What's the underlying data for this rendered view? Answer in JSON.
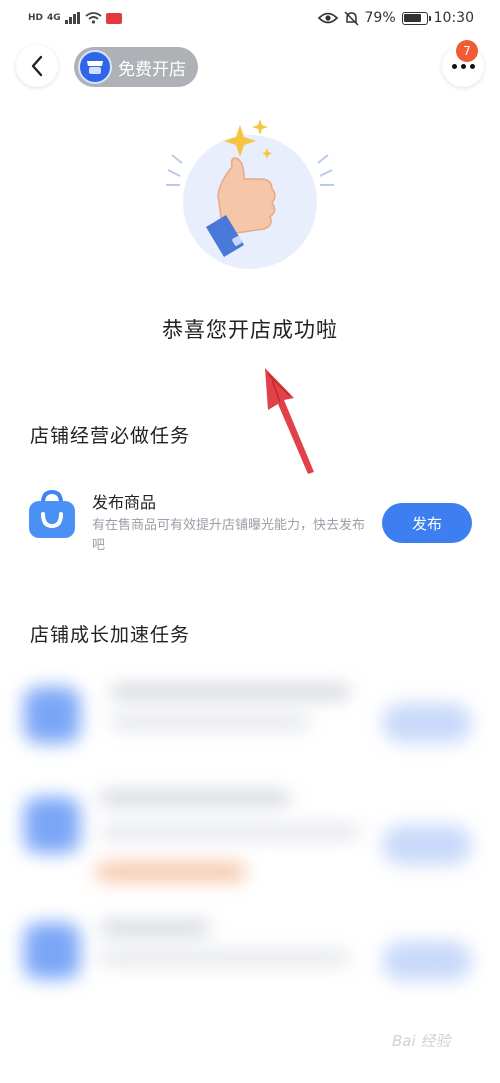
{
  "status_bar": {
    "left_labels": [
      "HD",
      "4G"
    ],
    "battery_percent": "79%",
    "battery_level": 0.79,
    "time": "10:30"
  },
  "header": {
    "title": "免费开店",
    "notification_count": "7"
  },
  "hero": {
    "illustration": "thumbs-up-with-sparkles",
    "success_message": "恭喜您开店成功啦"
  },
  "required_tasks": {
    "section_title": "店铺经营必做任务",
    "items": [
      {
        "icon": "shopping-bag-icon",
        "name": "发布商品",
        "description": "有在售商品可有效提升店铺曝光能力，快去发布吧",
        "button_label": "发布"
      }
    ]
  },
  "growth_tasks": {
    "section_title": "店铺成长加速任务"
  },
  "watermark": "Bai 经验",
  "colors": {
    "accent": "#3d7ef0",
    "title_pill": "#aeb1b6",
    "badge": "#ef5b34",
    "annotation_arrow": "#e0313a"
  }
}
